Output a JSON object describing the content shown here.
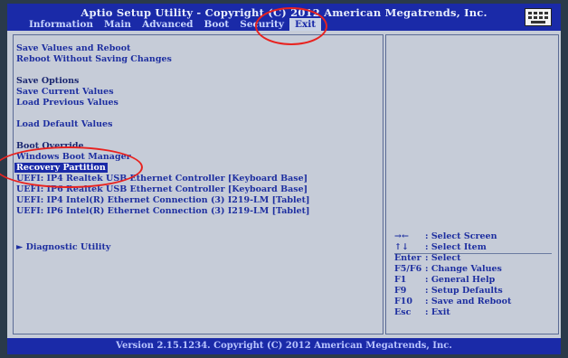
{
  "header": {
    "title": "Aptio Setup Utility - Copyright (C) 2012 American Megatrends, Inc.",
    "tabs": [
      "Information",
      "Main",
      "Advanced",
      "Boot",
      "Security",
      "Exit"
    ],
    "active_tab": "Exit",
    "keyboard_icon": "keyboard-icon"
  },
  "menu": {
    "save_values_and_reboot": "Save Values and Reboot",
    "reboot_without_saving": "Reboot Without Saving Changes",
    "save_options_heading": "Save Options",
    "save_current_values": "Save Current Values",
    "load_previous_values": "Load Previous Values",
    "load_default_values": "Load Default Values",
    "boot_override_heading": "Boot Override",
    "windows_boot_manager": "Windows Boot Manager",
    "recovery_partition": "Recovery Partition",
    "uefi_ip4_realtek": "UEFI: IP4 Realtek USB Ethernet Controller [Keyboard Base]",
    "uefi_ip6_realtek": "UEFI: IP6 Realtek USB Ethernet Controller [Keyboard Base]",
    "uefi_ip4_intel": "UEFI: IP4 Intel(R) Ethernet Connection (3) I219-LM [Tablet]",
    "uefi_ip6_intel": "UEFI: IP6 Intel(R) Ethernet Connection (3) I219-LM [Tablet]",
    "diagnostic_utility": "Diagnostic Utility",
    "selected_item": "Recovery Partition"
  },
  "help": [
    {
      "key": "→←",
      "desc": ": Select Screen"
    },
    {
      "key": "↑↓",
      "desc": ": Select Item"
    },
    {
      "key": "Enter",
      "desc": ": Select"
    },
    {
      "key": "F5/F6",
      "desc": ": Change Values"
    },
    {
      "key": "F1",
      "desc": ": General Help"
    },
    {
      "key": "F9",
      "desc": ": Setup Defaults"
    },
    {
      "key": "F10",
      "desc": ": Save and Reboot"
    },
    {
      "key": "Esc",
      "desc": ": Exit"
    }
  ],
  "footer": {
    "version": "Version 2.15.1234. Copyright (C) 2012 American Megatrends, Inc."
  },
  "colors": {
    "bios_blue": "#1a2aa8",
    "panel_gray": "#c6ccd8",
    "annotation_red": "#e8221f"
  }
}
